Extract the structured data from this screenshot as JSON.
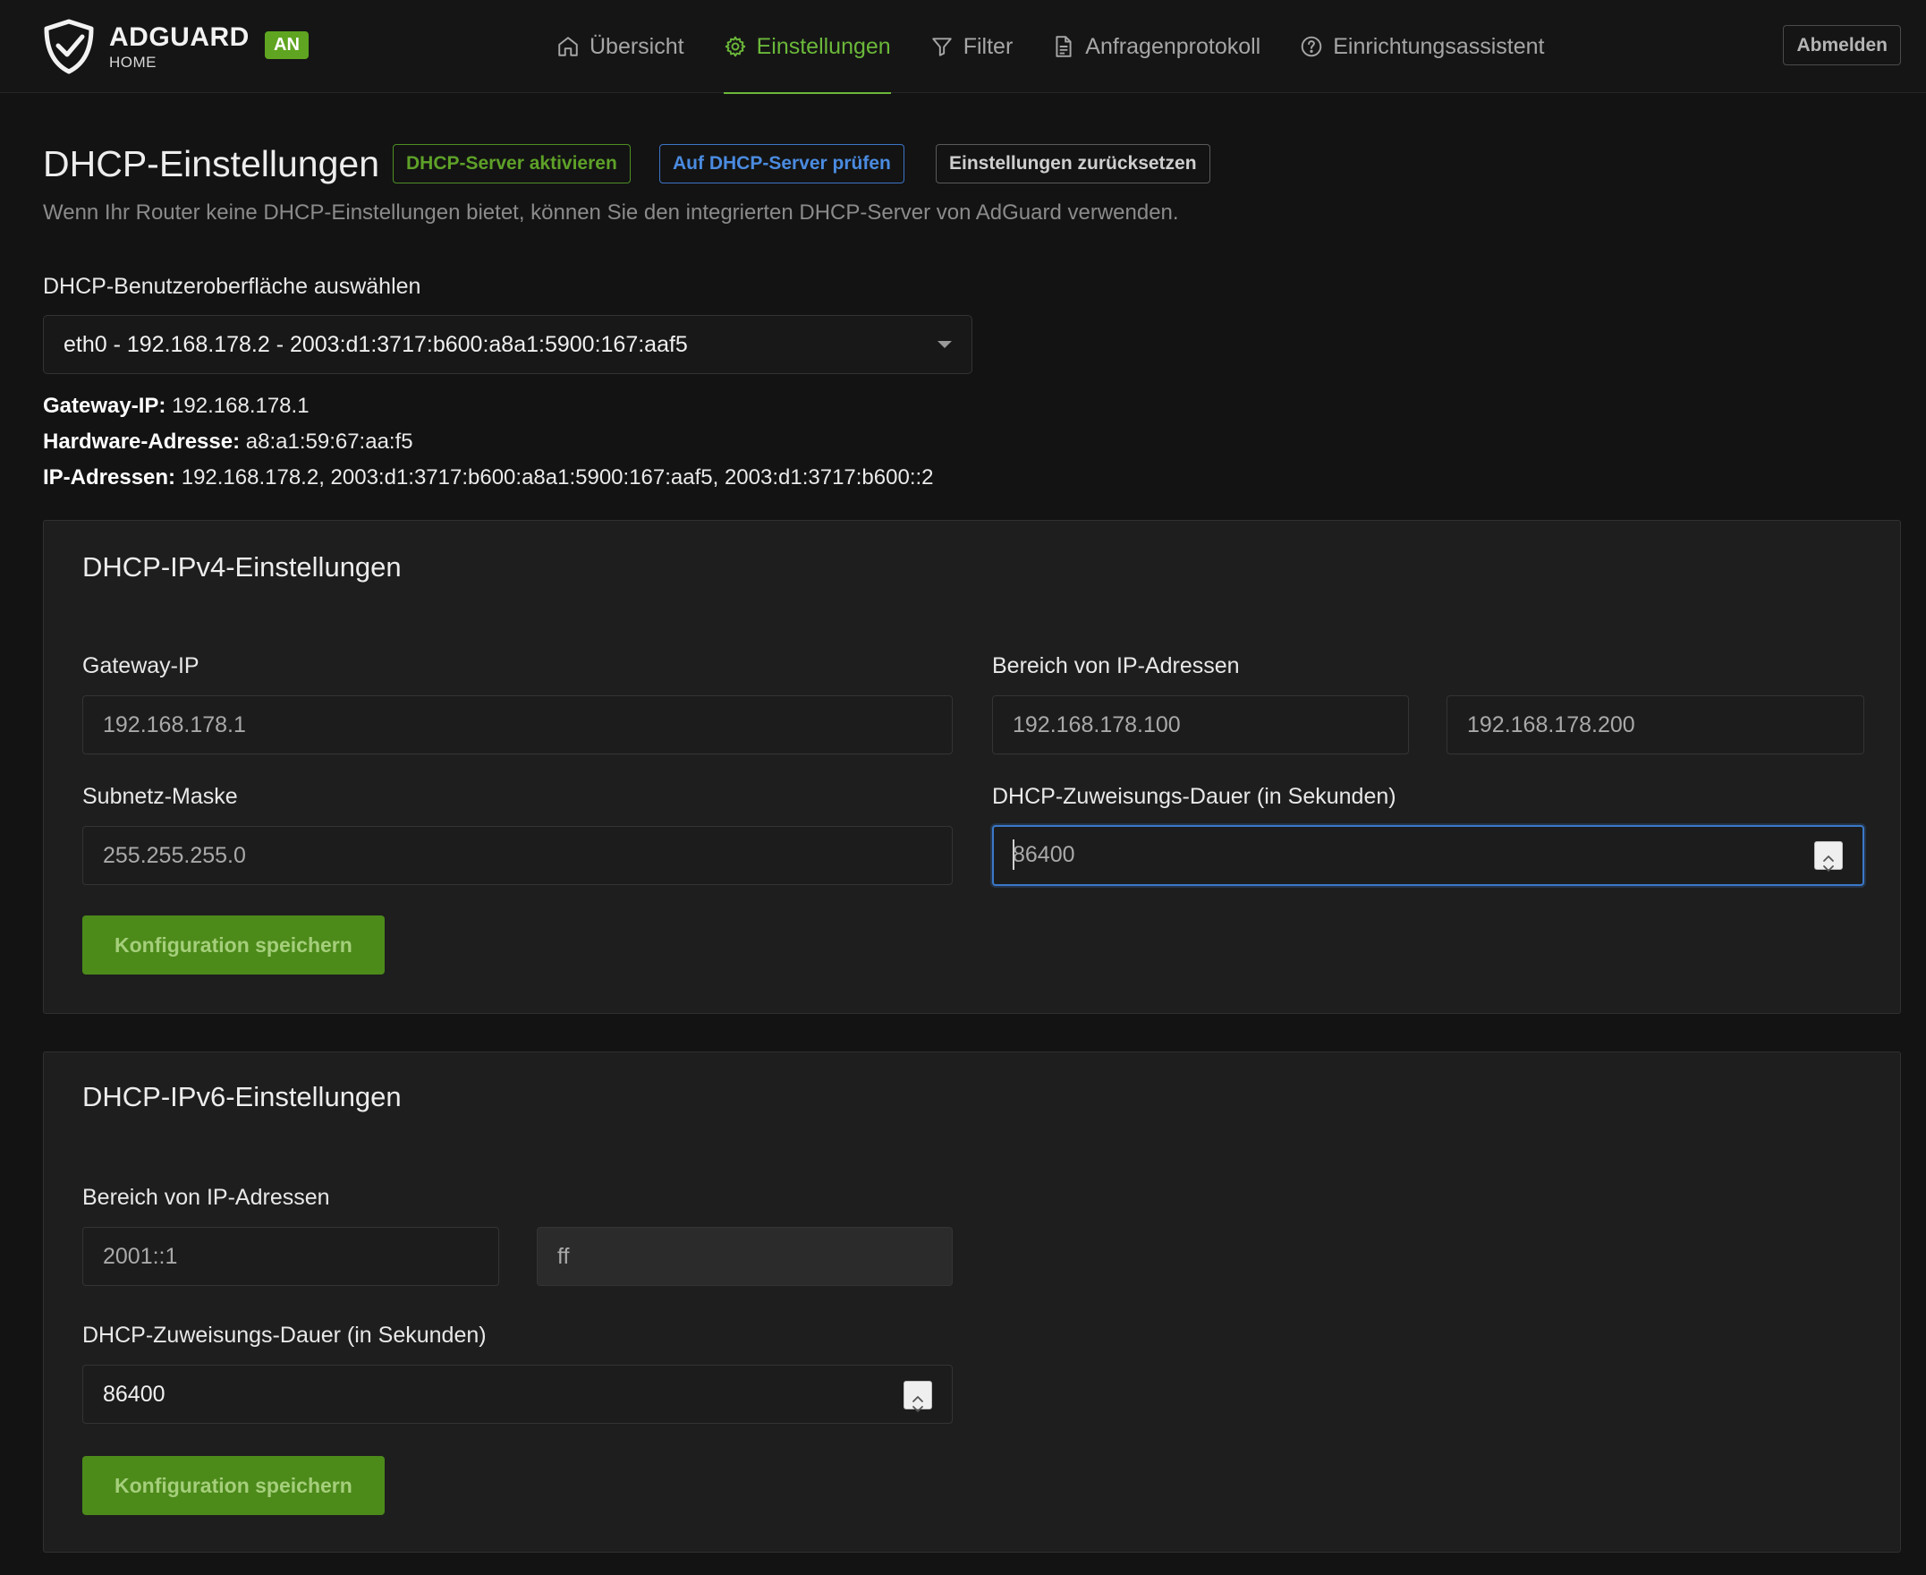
{
  "header": {
    "brand": "ADGUARD",
    "brand_sub": "HOME",
    "status_badge": "AN",
    "nav": [
      {
        "label": "Übersicht",
        "icon": "home-icon"
      },
      {
        "label": "Einstellungen",
        "icon": "gear-icon",
        "active": true
      },
      {
        "label": "Filter",
        "icon": "filter-icon"
      },
      {
        "label": "Anfragenprotokoll",
        "icon": "document-icon"
      },
      {
        "label": "Einrichtungsassistent",
        "icon": "help-circle-icon"
      }
    ],
    "logout_label": "Abmelden"
  },
  "page": {
    "title": "DHCP-Einstellungen",
    "btn_activate": "DHCP-Server aktivieren",
    "btn_check": "Auf DHCP-Server prüfen",
    "btn_reset": "Einstellungen zurücksetzen",
    "subtitle": "Wenn Ihr Router keine DHCP-Einstellungen bietet, können Sie den integrierten DHCP-Server von AdGuard verwenden."
  },
  "interface": {
    "label": "DHCP-Benutzeroberfläche auswählen",
    "selected": "eth0 - 192.168.178.2 - 2003:d1:3717:b600:a8a1:5900:167:aaf5",
    "gateway_label": "Gateway-IP:",
    "gateway_value": "192.168.178.1",
    "hw_label": "Hardware-Adresse:",
    "hw_value": "a8:a1:59:67:aa:f5",
    "ip_label": "IP-Adressen:",
    "ip_value": "192.168.178.2, 2003:d1:3717:b600:a8a1:5900:167:aaf5, 2003:d1:3717:b600::2"
  },
  "ipv4": {
    "title": "DHCP-IPv4-Einstellungen",
    "gateway_label": "Gateway-IP",
    "gateway_value": "192.168.178.1",
    "range_label": "Bereich von IP-Adressen",
    "range_start": "192.168.178.100",
    "range_end": "192.168.178.200",
    "mask_label": "Subnetz-Maske",
    "mask_value": "255.255.255.0",
    "lease_label": "DHCP-Zuweisungs-Dauer (in Sekunden)",
    "lease_value": "86400",
    "save_label": "Konfiguration speichern"
  },
  "ipv6": {
    "title": "DHCP-IPv6-Einstellungen",
    "range_label": "Bereich von IP-Adressen",
    "range_start": "2001::1",
    "range_end": "ff",
    "lease_label": "DHCP-Zuweisungs-Dauer (in Sekunden)",
    "lease_value": "86400",
    "save_label": "Konfiguration speichern"
  },
  "colors": {
    "accent_green": "#6bb83a",
    "badge_green": "#5fa521",
    "link_blue": "#4a8be0",
    "save_green": "#4c8a1a"
  }
}
